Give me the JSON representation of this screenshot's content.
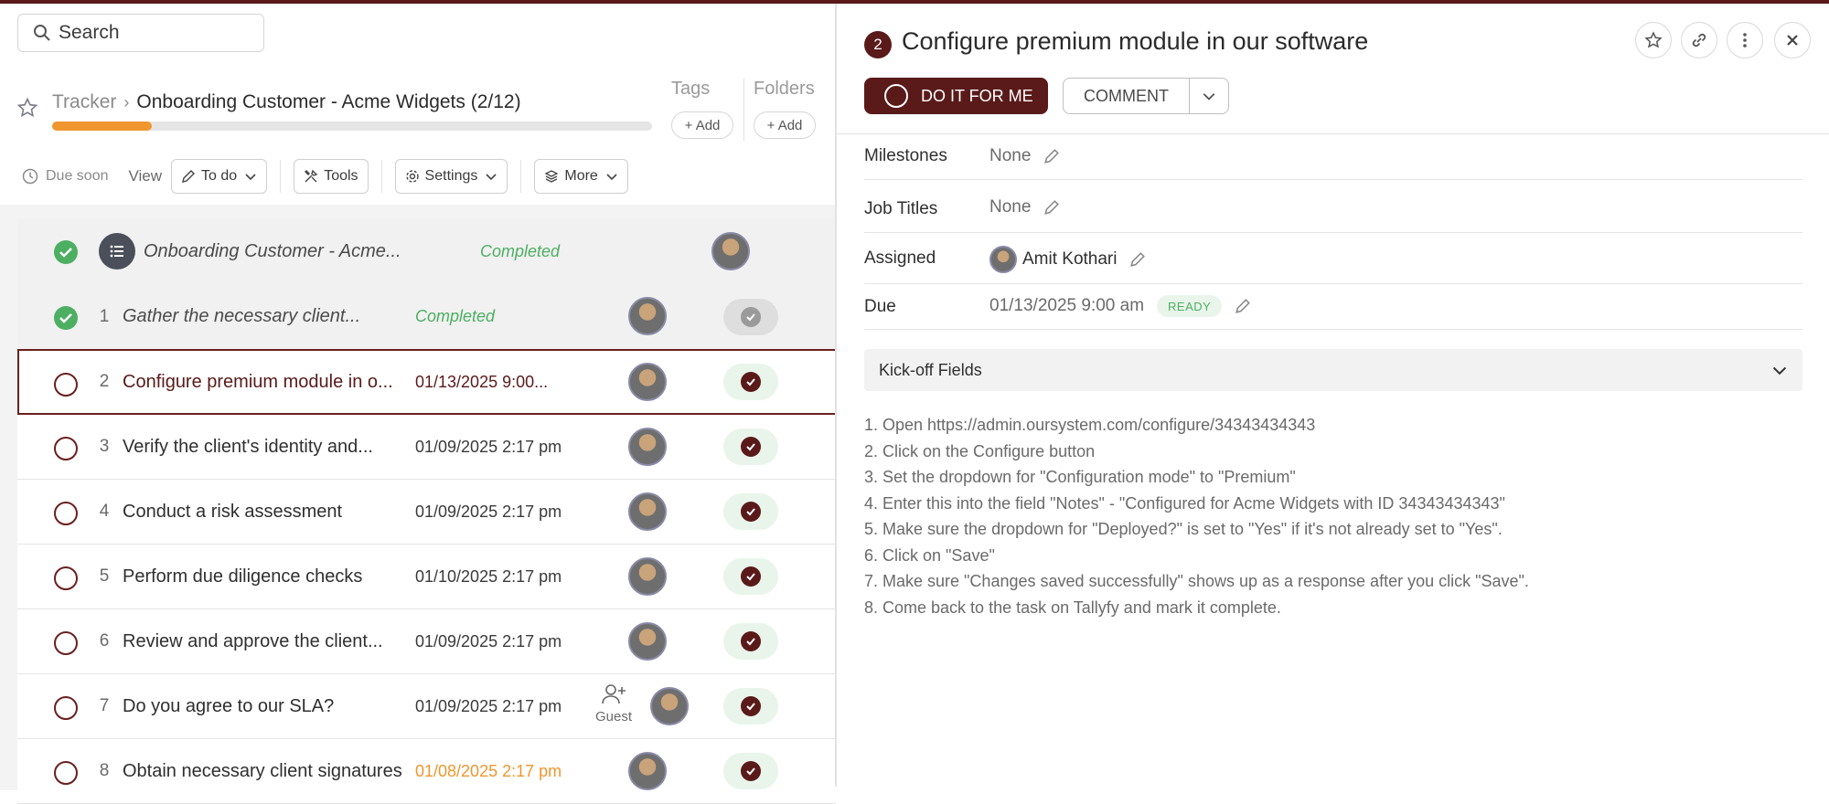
{
  "search": {
    "label": "Search"
  },
  "breadcrumb": {
    "root": "Tracker",
    "current": "Onboarding Customer - Acme Widgets (2/12)"
  },
  "progress": {
    "fraction": 0.1667
  },
  "tags": {
    "label": "Tags",
    "add": "+ Add"
  },
  "folders": {
    "label": "Folders",
    "add": "+ Add"
  },
  "toolbar": {
    "due_soon": "Due soon",
    "view": "View",
    "todo": "To do",
    "tools": "Tools",
    "settings": "Settings",
    "more": "More"
  },
  "process_row": {
    "title": "Onboarding Customer - Acme...",
    "status": "Completed"
  },
  "tasks": [
    {
      "num": "1",
      "title": "Gather the necessary client...",
      "date": "Completed"
    },
    {
      "num": "2",
      "title": "Configure premium module in o...",
      "date": "01/13/2025 9:00..."
    },
    {
      "num": "3",
      "title": "Verify the client's identity and...",
      "date": "01/09/2025 2:17 pm"
    },
    {
      "num": "4",
      "title": "Conduct a risk assessment",
      "date": "01/09/2025 2:17 pm"
    },
    {
      "num": "5",
      "title": "Perform due diligence checks",
      "date": "01/10/2025 2:17 pm"
    },
    {
      "num": "6",
      "title": "Review and approve the client...",
      "date": "01/09/2025 2:17 pm"
    },
    {
      "num": "7",
      "title": "Do you agree to our SLA?",
      "date": "01/09/2025 2:17 pm",
      "guest": "Guest"
    },
    {
      "num": "8",
      "title": "Obtain necessary client signatures",
      "date": "01/08/2025 2:17 pm"
    }
  ],
  "detail": {
    "number": "2",
    "title": "Configure premium module in our software",
    "do_it": "DO IT FOR ME",
    "comment": "COMMENT",
    "milestones": {
      "label": "Milestones",
      "value": "None"
    },
    "job_titles": {
      "label": "Job Titles",
      "value": "None"
    },
    "assigned": {
      "label": "Assigned",
      "value": "Amit Kothari"
    },
    "due": {
      "label": "Due",
      "value": "01/13/2025 9:00 am",
      "status": "READY"
    },
    "kickoff": "Kick-off Fields",
    "steps": [
      "1. Open https://admin.oursystem.com/configure/34343434343",
      "2. Click on the Configure button",
      "3. Set the dropdown for \"Configuration mode\" to \"Premium\"",
      "4. Enter this into the field \"Notes\" - \"Configured for Acme Widgets with ID 34343434343\"",
      "5. Make sure the dropdown for \"Deployed?\" is set to \"Yes\" if it's not already set to \"Yes\".",
      "6. Click on \"Save\"",
      "7. Make sure \"Changes saved successfully\" shows up as a response after you click \"Save\".",
      "8. Come back to the task on Tallyfy and mark it complete."
    ]
  },
  "colors": {
    "brand": "#5a1a1a",
    "success": "#4caf61",
    "warning": "#f0962e"
  }
}
